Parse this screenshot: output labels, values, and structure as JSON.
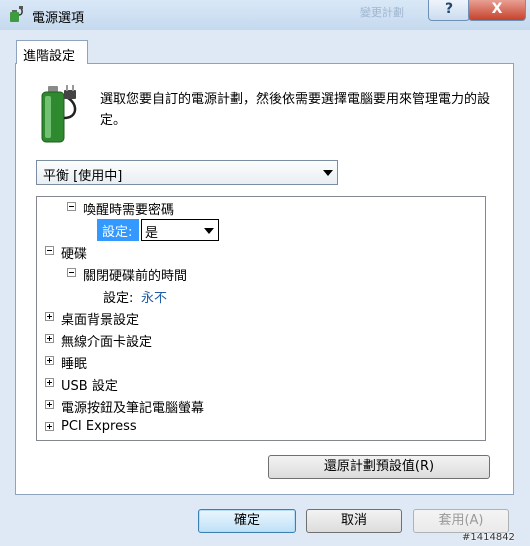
{
  "window": {
    "title": "電源選項",
    "background_title": "變更計劃",
    "help_glyph": "?",
    "close_glyph": "X"
  },
  "tab": {
    "label": "進階設定"
  },
  "description": "選取您要自訂的電源計劃，然後依需要選擇電腦要用來管理電力的設定。",
  "plan_select": {
    "value": "平衡 [使用中]"
  },
  "tree": {
    "rows": [
      {
        "label": "喚醒時需要密碼",
        "expander": "minus"
      },
      {
        "setting_label": "設定:",
        "select_value": "是"
      },
      {
        "label": "硬碟",
        "expander": "minus"
      },
      {
        "label": "關閉硬碟前的時間",
        "expander": "minus"
      },
      {
        "setting_label": "設定:",
        "value": "永不"
      },
      {
        "label": "桌面背景設定",
        "expander": "plus"
      },
      {
        "label": "無線介面卡設定",
        "expander": "plus"
      },
      {
        "label": "睡眠",
        "expander": "plus"
      },
      {
        "label": "USB 設定",
        "expander": "plus"
      },
      {
        "label": "電源按鈕及筆記電腦螢幕",
        "expander": "plus"
      },
      {
        "label": "PCI Express",
        "expander": "plus"
      }
    ]
  },
  "buttons": {
    "restore": "還原計劃預設值(R)",
    "ok": "確定",
    "cancel": "取消",
    "apply": "套用(A)"
  },
  "watermark": "#1414842",
  "colors": {
    "selection": "#3399ff",
    "link_value": "#1f5ca8",
    "close_button": "#c6422c"
  }
}
